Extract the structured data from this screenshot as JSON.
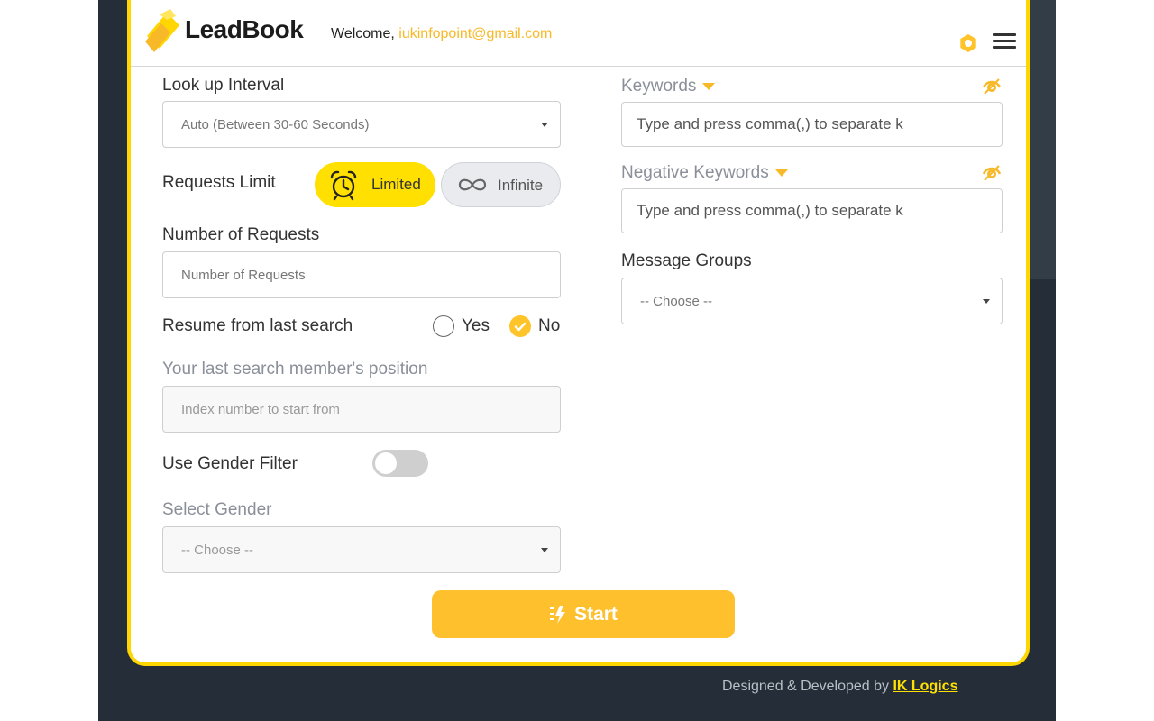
{
  "header": {
    "logo_text": "LeadBook",
    "welcome_prefix": "Welcome, ",
    "user_email": "iukinfopoint@gmail.com"
  },
  "form": {
    "lookup_interval": {
      "label": "Look up Interval",
      "value": "Auto (Between 30-60 Seconds)"
    },
    "requests_limit": {
      "label": "Requests Limit",
      "limited_label": "Limited",
      "infinite_label": "Infinite",
      "selected": "Limited"
    },
    "number_of_requests": {
      "label": "Number of Requests",
      "placeholder": "Number of Requests"
    },
    "resume": {
      "label": "Resume from last search",
      "yes_label": "Yes",
      "no_label": "No",
      "selected": "No"
    },
    "last_position": {
      "label": "Your last search member's position",
      "placeholder": "Index number to start from"
    },
    "gender_filter": {
      "label": "Use Gender Filter",
      "enabled": false
    },
    "select_gender": {
      "label": "Select Gender",
      "value": "-- Choose --"
    },
    "keywords": {
      "label": "Keywords",
      "placeholder": "Type and press comma(,) to separate k"
    },
    "negative_keywords": {
      "label": "Negative Keywords",
      "placeholder": "Type and press comma(,) to separate k"
    },
    "message_groups": {
      "label": "Message Groups",
      "value": "-- Choose --"
    },
    "start_label": "Start"
  },
  "footer": {
    "prefix": "Designed & Developed by ",
    "brand": "IK Logics"
  },
  "colors": {
    "accent_yellow": "#ffd600",
    "button_orange": "#fec02d",
    "email_color": "#f7b928",
    "dark_bg": "#252e38"
  },
  "icons": [
    "logo-icon",
    "settings-icon",
    "menu-icon",
    "alarm-clock-icon",
    "infinity-icon",
    "check-icon",
    "hide-icon",
    "caret-down-icon",
    "start-icon"
  ]
}
